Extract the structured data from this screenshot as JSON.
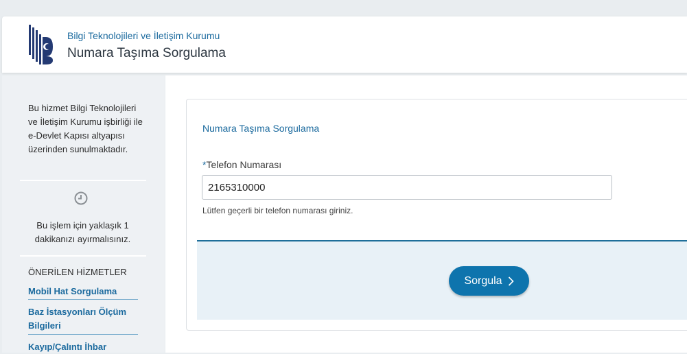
{
  "header": {
    "org_name": "Bilgi Teknolojileri ve İletişim Kurumu",
    "title": "Numara Taşıma Sorgulama",
    "logo_icon": "btk-logo-icon"
  },
  "sidebar": {
    "info_text": "Bu hizmet Bilgi Teknolojileri ve İletişim Kurumu işbirliği ile e-Devlet Kapısı altyapısı üzerinden sunulmaktadır.",
    "time_icon": "clock-icon",
    "time_text": "Bu işlem için yaklaşık 1 dakikanızı ayırmalısınız.",
    "recommended_title": "ÖNERİLEN HİZMETLER",
    "recommended": [
      {
        "label": "Mobil Hat Sorgulama"
      },
      {
        "label": "Baz İstasyonları Ölçüm Bilgileri"
      },
      {
        "label": "Kayıp/Çalıntı İhbar"
      }
    ]
  },
  "form": {
    "title": "Numara Taşıma Sorgulama",
    "required_mark": "*",
    "phone_label": "Telefon Numarası",
    "phone_value": "2165310000",
    "help_text": "Lütfen geçerli bir telefon numarası giriniz.",
    "submit_label": "Sorgula",
    "submit_icon": "chevron-right-icon"
  },
  "colors": {
    "brand_blue": "#1b6a9e",
    "button_blue": "#0e74ad",
    "action_bg": "#e8f1f7"
  }
}
